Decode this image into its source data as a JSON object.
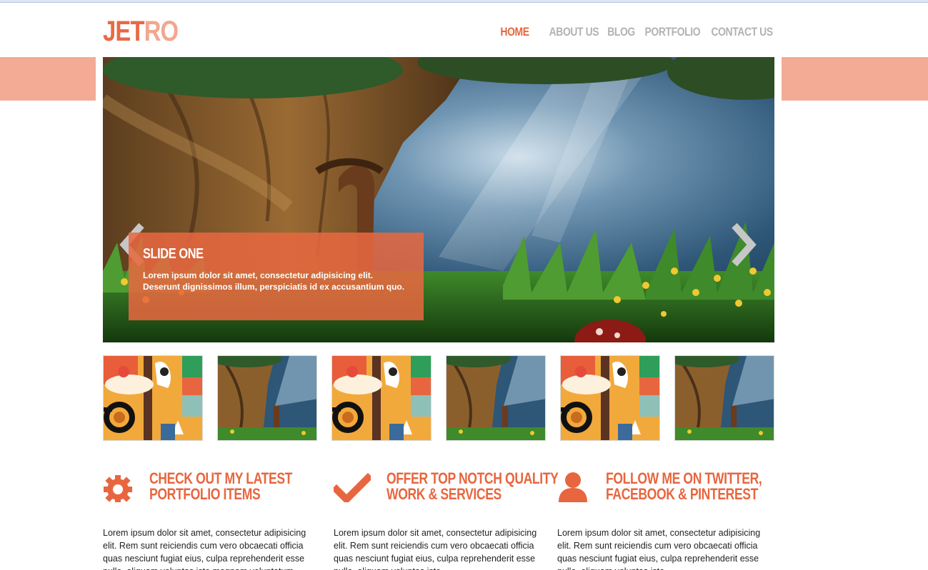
{
  "brand": {
    "logo_part1": "JET",
    "logo_part2": "RO"
  },
  "nav": {
    "items": [
      {
        "label": "HOME",
        "active": true
      },
      {
        "label": "ABOUT US"
      },
      {
        "label": "BLOG"
      },
      {
        "label": "PORTFOLIO"
      },
      {
        "label": "CONTACT US"
      }
    ]
  },
  "slider": {
    "slide_title": "SLIDE ONE",
    "slide_text": "Lorem ipsum dolor sit amet, consectetur adipisicing elit. Deserunt dignissimos illum, perspiciatis id ex accusantium quo.",
    "prev_icon": "chevron-left-icon",
    "next_icon": "chevron-right-icon"
  },
  "thumbnails": [
    "illustration",
    "tree",
    "illustration",
    "tree",
    "illustration",
    "tree"
  ],
  "features": [
    {
      "icon": "gear-icon",
      "title_line1": "CHECK OUT MY LATEST",
      "title_line2": "PORTFOLIO ITEMS",
      "text": "Lorem ipsum dolor sit amet, consectetur adipisicing elit. Rem sunt reiciendis cum vero obcaecati officia quas nesciunt fugiat eius, culpa reprehenderit esse nulla, aliquam voluptas iste magnam voluptatum."
    },
    {
      "icon": "checkmark-icon",
      "title_line1": "OFFER TOP NOTCH QUALITY",
      "title_line2": "WORK & SERVICES",
      "text": "Lorem ipsum dolor sit amet, consectetur adipisicing elit. Rem sunt reiciendis cum vero obcaecati officia quas nesciunt fugiat eius, culpa reprehenderit esse nulla, aliquam voluptas iste."
    },
    {
      "icon": "user-icon",
      "title_line1": "FOLLOW ME ON TWITTER,",
      "title_line2": "FACEBOOK & PINTEREST",
      "text": "Lorem ipsum dolor sit amet, consectetur adipisicing elit. Rem sunt reiciendis cum vero obcaecati officia quas nesciunt fugiat eius, culpa reprehenderit esse nulla, aliquam voluptas iste."
    }
  ],
  "colors": {
    "accent": "#e8663f",
    "band": "#f3ab96",
    "nav_inactive": "#b3b3b3"
  }
}
